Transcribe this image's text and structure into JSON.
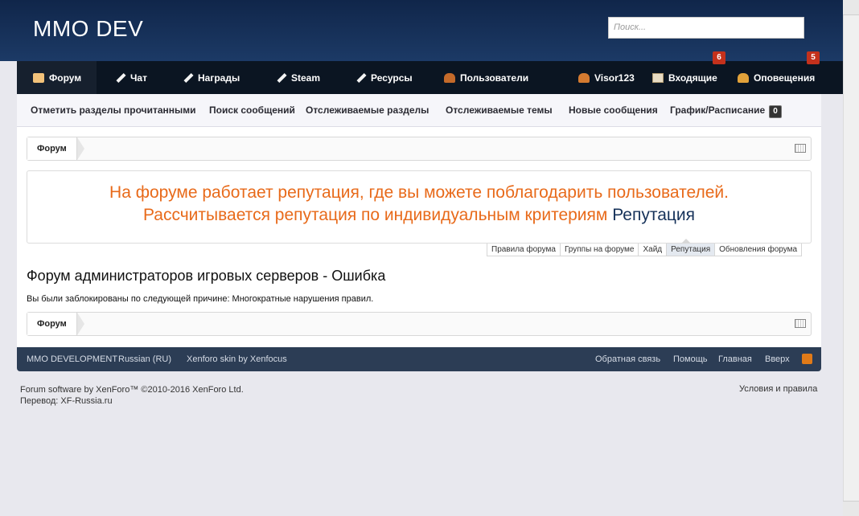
{
  "header": {
    "logo": "MMO DEV",
    "search_placeholder": "Поиск..."
  },
  "navbar": {
    "tabs": [
      {
        "label": "Форум",
        "icon": "forum-icon",
        "active": true
      },
      {
        "label": "Чат",
        "icon": "pencil-icon"
      },
      {
        "label": "Награды",
        "icon": "pencil-icon"
      },
      {
        "label": "Steam",
        "icon": "pencil-icon"
      },
      {
        "label": "Ресурсы",
        "icon": "pencil-icon"
      },
      {
        "label": "Пользователи",
        "icon": "users-icon"
      }
    ],
    "user": {
      "label": "Visor123",
      "icon": "user-icon"
    },
    "inbox": {
      "label": "Входящие",
      "badge": "6",
      "icon": "inbox-icon"
    },
    "alerts": {
      "label": "Оповещения",
      "badge": "5",
      "icon": "bell-icon"
    },
    "badge_color": "#c4311c"
  },
  "subnav": {
    "items": [
      "Отметить разделы прочитанными",
      "Поиск сообщений",
      "Отслеживаемые разделы",
      "Отслеживаемые темы",
      "Новые сообщения",
      "График/Расписание"
    ],
    "schedule_count": "0"
  },
  "breadcrumb": {
    "label": "Форум"
  },
  "notice": {
    "line1": "На форуме работает репутация, где вы можете поблагодарить пользователей.",
    "line2": "Рассчитывается репутация по индивидуальным критериям",
    "link": "Репутация",
    "accent_color": "#e86a1a"
  },
  "notice_tabs": [
    "Правила форума",
    "Группы на форуме",
    "Хайд",
    "Репутация",
    "Обновления форума"
  ],
  "main": {
    "title": "Форум администраторов игровых серверов - Ошибка",
    "message": "Вы были заблокированы по следующей причине: Многократные нарушения правил."
  },
  "footer": {
    "left": [
      "MMO DEVELOPMENT",
      "Russian (RU)",
      "Xenforo skin by Xenfocus"
    ],
    "right": [
      "Обратная связь",
      "Помощь",
      "Главная",
      "Вверх"
    ]
  },
  "copyright": {
    "line1": "Forum software by XenForo™ ©2010-2016 XenForo Ltd.",
    "line2": "Перевод: XF-Russia.ru",
    "terms": "Условия и правила"
  }
}
